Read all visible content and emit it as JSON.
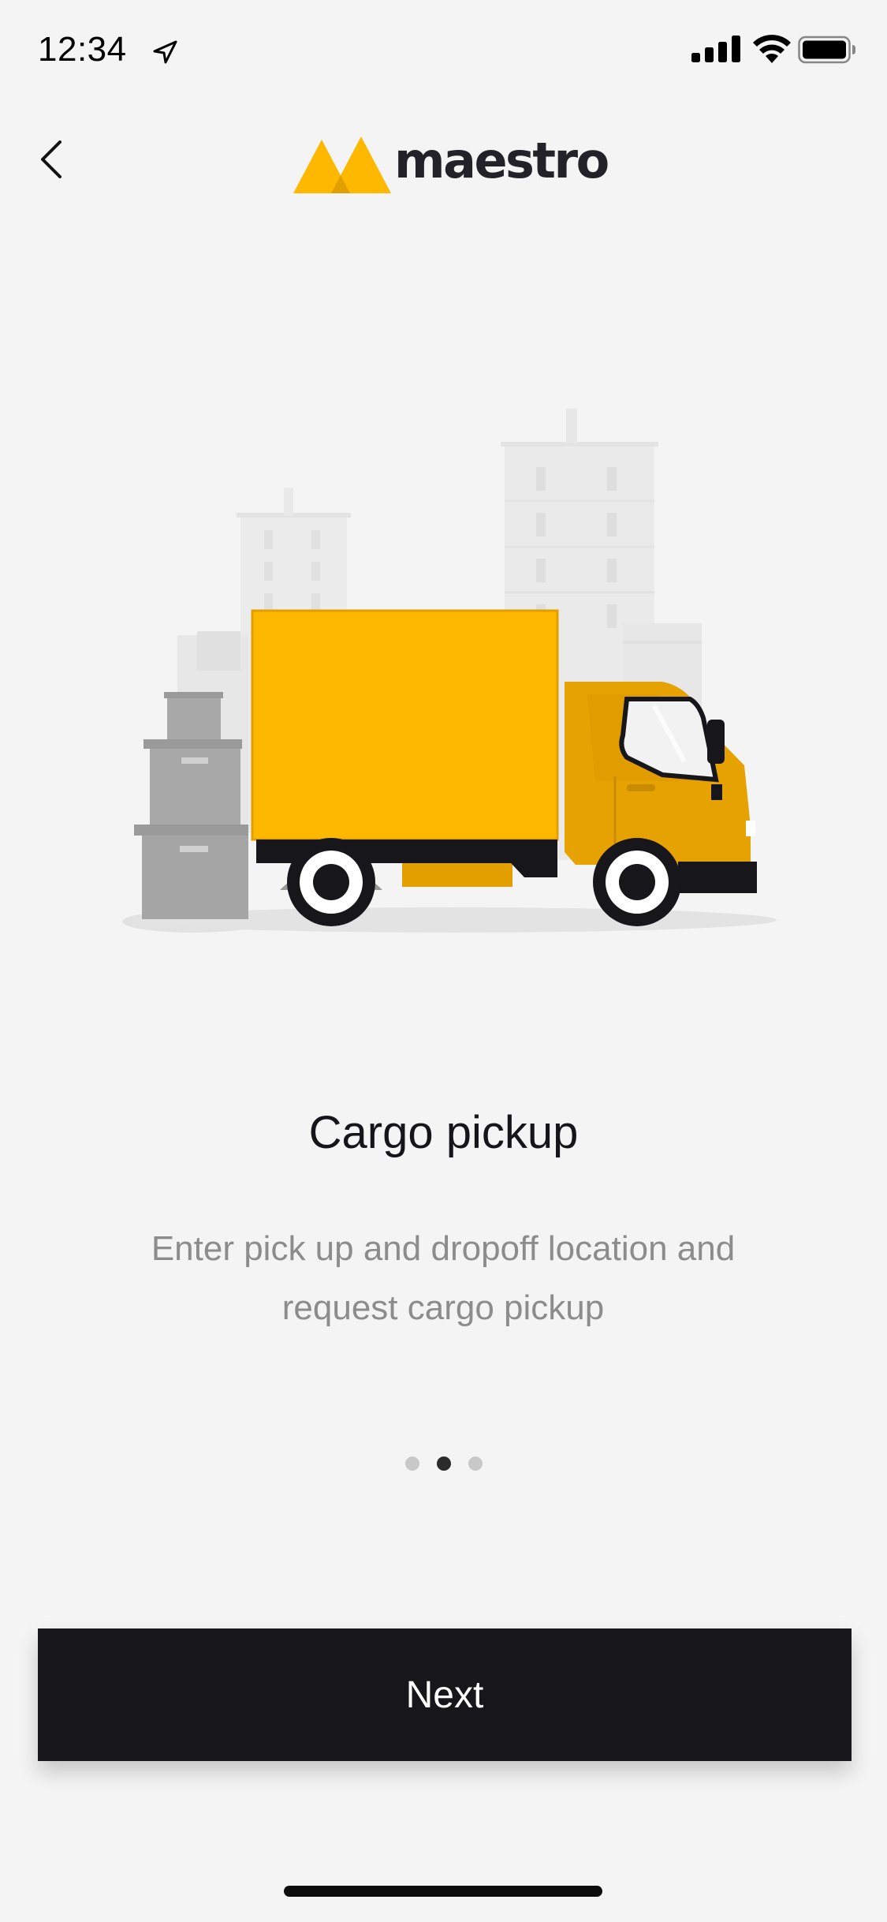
{
  "status_bar": {
    "time": "12:34",
    "location_icon": "location-arrow-icon",
    "signal_icon": "cellular-signal-icon",
    "wifi_icon": "wifi-icon",
    "battery_icon": "battery-icon"
  },
  "header": {
    "back_icon": "chevron-left-icon",
    "logo_text": "maestro"
  },
  "onboarding": {
    "illustration": "delivery-truck-illustration",
    "title": "Cargo pickup",
    "description": "Enter pick up and dropoff location and request cargo pickup",
    "page_indicator": {
      "total": 3,
      "active_index": 1
    }
  },
  "actions": {
    "next_label": "Next"
  },
  "colors": {
    "brand_yellow": "#FFB800",
    "brand_yellow_dark": "#E39E00",
    "button_bg": "#16161B",
    "background": "#F4F4F4",
    "text_secondary": "#8C8C8C"
  }
}
